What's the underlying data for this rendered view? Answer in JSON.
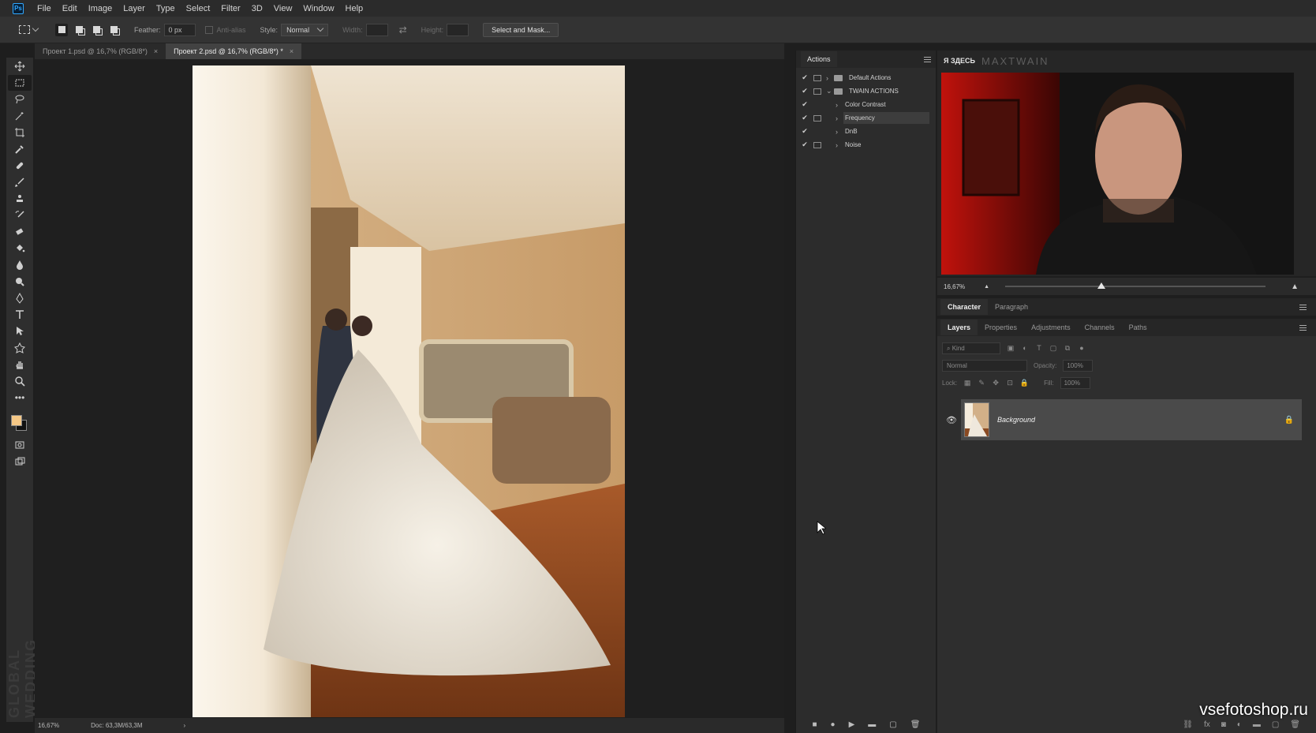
{
  "menubar": {
    "logo": "Ps",
    "items": [
      "File",
      "Edit",
      "Image",
      "Layer",
      "Type",
      "Select",
      "Filter",
      "3D",
      "View",
      "Window",
      "Help"
    ]
  },
  "options": {
    "feather_label": "Feather:",
    "feather_value": "0 px",
    "antialias_label": "Anti-alias",
    "style_label": "Style:",
    "style_value": "Normal",
    "width_label": "Width:",
    "height_label": "Height:",
    "select_mask_label": "Select and Mask..."
  },
  "doc_tabs": [
    {
      "title": "Проект 1.psd @ 16,7% (RGB/8*)",
      "close": "×"
    },
    {
      "title": "Проект 2.psd @ 16,7% (RGB/8*) *",
      "close": "×"
    }
  ],
  "status": {
    "zoom": "16,67%",
    "doc": "Doc: 63,3M/63,3M",
    "arrow": "›"
  },
  "actions_panel": {
    "title": "Actions",
    "rows": [
      {
        "label": "Default Actions",
        "check": "✔",
        "caret": "›",
        "folder": true,
        "dialog": true
      },
      {
        "label": "TWAIN ACTIONS",
        "check": "✔",
        "caret": "⌄",
        "folder": true,
        "dialog": true
      },
      {
        "label": "Color Contrast",
        "check": "✔",
        "caret": "›",
        "folder": false,
        "dialog": false
      },
      {
        "label": "Frequency",
        "check": "✔",
        "caret": "›",
        "folder": false,
        "dialog": true,
        "selected": true
      },
      {
        "label": "DnB",
        "check": "✔",
        "caret": "›",
        "folder": false,
        "dialog": false
      },
      {
        "label": "Noise",
        "check": "✔",
        "caret": "›",
        "folder": false,
        "dialog": true
      }
    ],
    "footer_icons": [
      "stop-icon",
      "record-icon",
      "play-icon",
      "new-set-icon",
      "new-action-icon",
      "trash-icon"
    ],
    "footer_glyphs": [
      "■",
      "●",
      "▶",
      "▬",
      "▢",
      "🗑"
    ]
  },
  "video": {
    "tag": "Я ЗДЕСЬ",
    "brand": "MAXTWAIN"
  },
  "navigator": {
    "zoom": "16,67%",
    "zoom_level": 0.37
  },
  "char_tabs": [
    "Character",
    "Paragraph"
  ],
  "layers_tabs": [
    "Layers",
    "Properties",
    "Adjustments",
    "Channels",
    "Paths"
  ],
  "layers": {
    "kind_placeholder": "Kind",
    "blend_mode": "Normal",
    "opacity_label": "Opacity:",
    "opacity_value": "100%",
    "lock_label": "Lock:",
    "fill_label": "Fill:",
    "fill_value": "100%",
    "layer_name": "Background",
    "footer_glyphs": [
      "⛓",
      "fx",
      "◙",
      "◐",
      "▬",
      "▢",
      "🗑"
    ]
  },
  "watermark": {
    "site": "vsefotoshop.ru",
    "left_text": "GLOBAL WEDDING"
  },
  "colors": {
    "foreground": "#f5c887",
    "background": "#111111",
    "accent_ps": "#31a8ff"
  }
}
